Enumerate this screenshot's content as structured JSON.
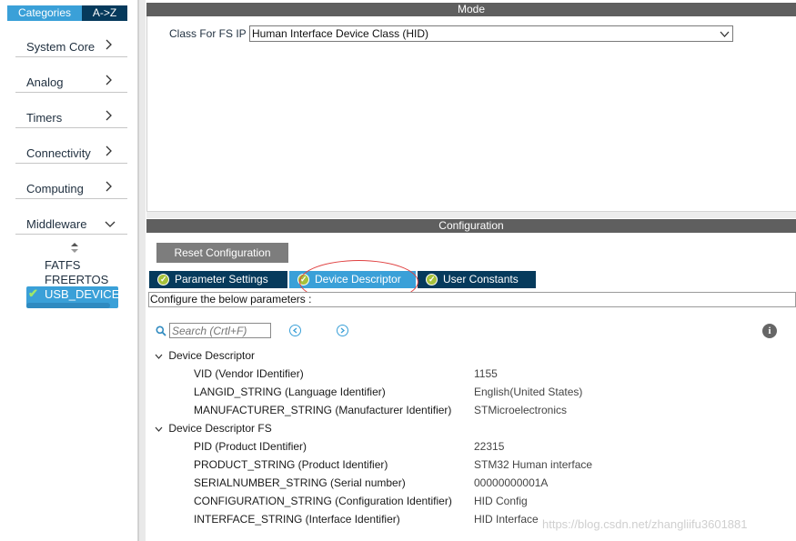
{
  "sidebar": {
    "tabs": {
      "categories": "Categories",
      "az": "A->Z"
    },
    "categories": [
      {
        "label": "System Core",
        "expanded": false
      },
      {
        "label": "Analog",
        "expanded": false
      },
      {
        "label": "Timers",
        "expanded": false
      },
      {
        "label": "Connectivity",
        "expanded": false
      },
      {
        "label": "Computing",
        "expanded": false
      },
      {
        "label": "Middleware",
        "expanded": true
      }
    ],
    "middleware_items": [
      "FATFS",
      "FREERTOS",
      "USB_DEVICE"
    ],
    "selected_item": "USB_DEVICE"
  },
  "mode": {
    "header": "Mode",
    "class_label": "Class For FS IP",
    "class_value": "Human Interface Device Class (HID)"
  },
  "configuration": {
    "header": "Configuration",
    "reset_button": "Reset Configuration",
    "tabs": [
      "Parameter Settings",
      "Device Descriptor",
      "User Constants"
    ],
    "active_tab": "Device Descriptor",
    "configure_text": "Configure the below parameters :",
    "search_placeholder": "Search (Crtl+F)",
    "groups": [
      {
        "name": "Device Descriptor",
        "rows": [
          {
            "param": "VID (Vendor IDentifier)",
            "value": "1155"
          },
          {
            "param": "LANGID_STRING (Language Identifier)",
            "value": "English(United States)"
          },
          {
            "param": "MANUFACTURER_STRING (Manufacturer Identifier)",
            "value": "STMicroelectronics"
          }
        ]
      },
      {
        "name": "Device Descriptor FS",
        "rows": [
          {
            "param": "PID (Product IDentifier)",
            "value": "22315"
          },
          {
            "param": "PRODUCT_STRING (Product Identifier)",
            "value": "STM32 Human interface"
          },
          {
            "param": "SERIALNUMBER_STRING (Serial number)",
            "value": "00000000001A"
          },
          {
            "param": "CONFIGURATION_STRING (Configuration Identifier)",
            "value": "HID Config"
          },
          {
            "param": "INTERFACE_STRING (Interface Identifier)",
            "value": "HID Interface"
          }
        ]
      }
    ]
  },
  "watermark": "https://blog.csdn.net/zhangliifu3601881",
  "colors": {
    "accent": "#3aa0d8",
    "dark_tab": "#063a5c",
    "header_gray": "#5f5f5f",
    "ok_green": "#a6c13c",
    "annotation_red": "#e04040"
  },
  "icons": {
    "search": "search-icon",
    "info": "info-icon",
    "prev": "prev-circle-icon",
    "next": "next-circle-icon"
  }
}
